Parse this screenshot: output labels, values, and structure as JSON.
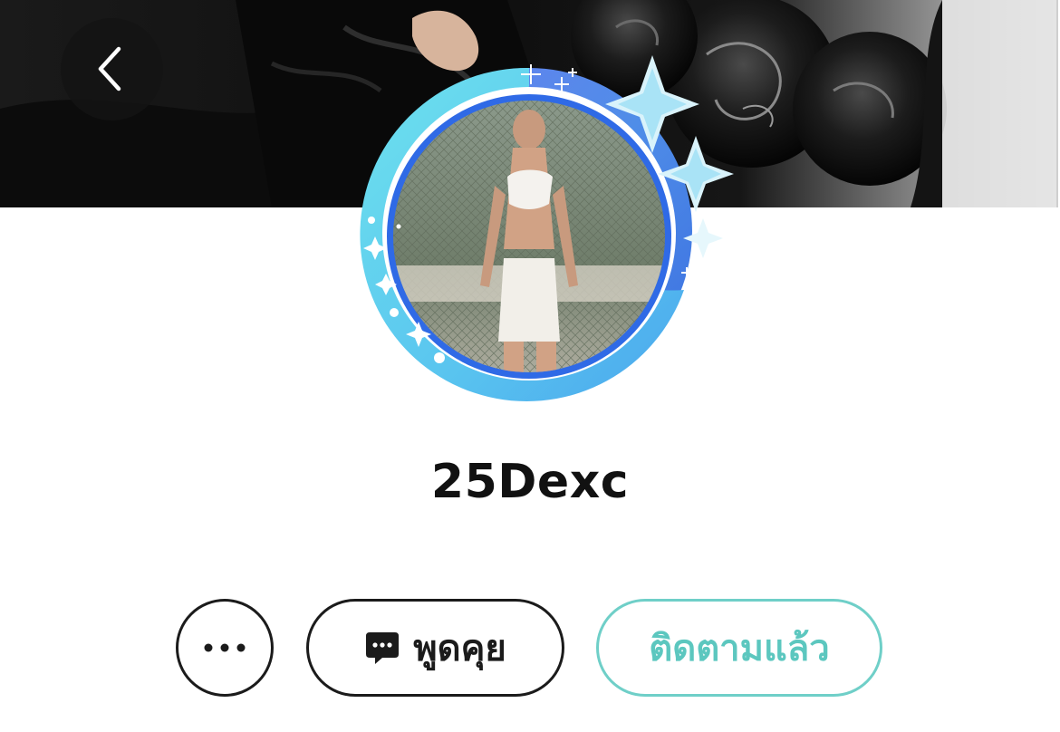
{
  "profile": {
    "username": "25Dexc",
    "cover_image": "dark-black-roses-cover-photo",
    "avatar_image": "profile-photo",
    "avatar_frame": "blue-crescent-sparkle-frame"
  },
  "header": {
    "back_icon": "chevron-left-icon"
  },
  "actions": {
    "more_icon": "more-dots-icon",
    "chat_icon": "chat-bubble-icon",
    "chat_label": "พูดคุย",
    "follow_label": "ติดตามแล้ว"
  },
  "colors": {
    "follow_accent": "#5cc7bf",
    "frame_blue": "#5b8df0",
    "frame_cyan": "#6fd8ea"
  }
}
